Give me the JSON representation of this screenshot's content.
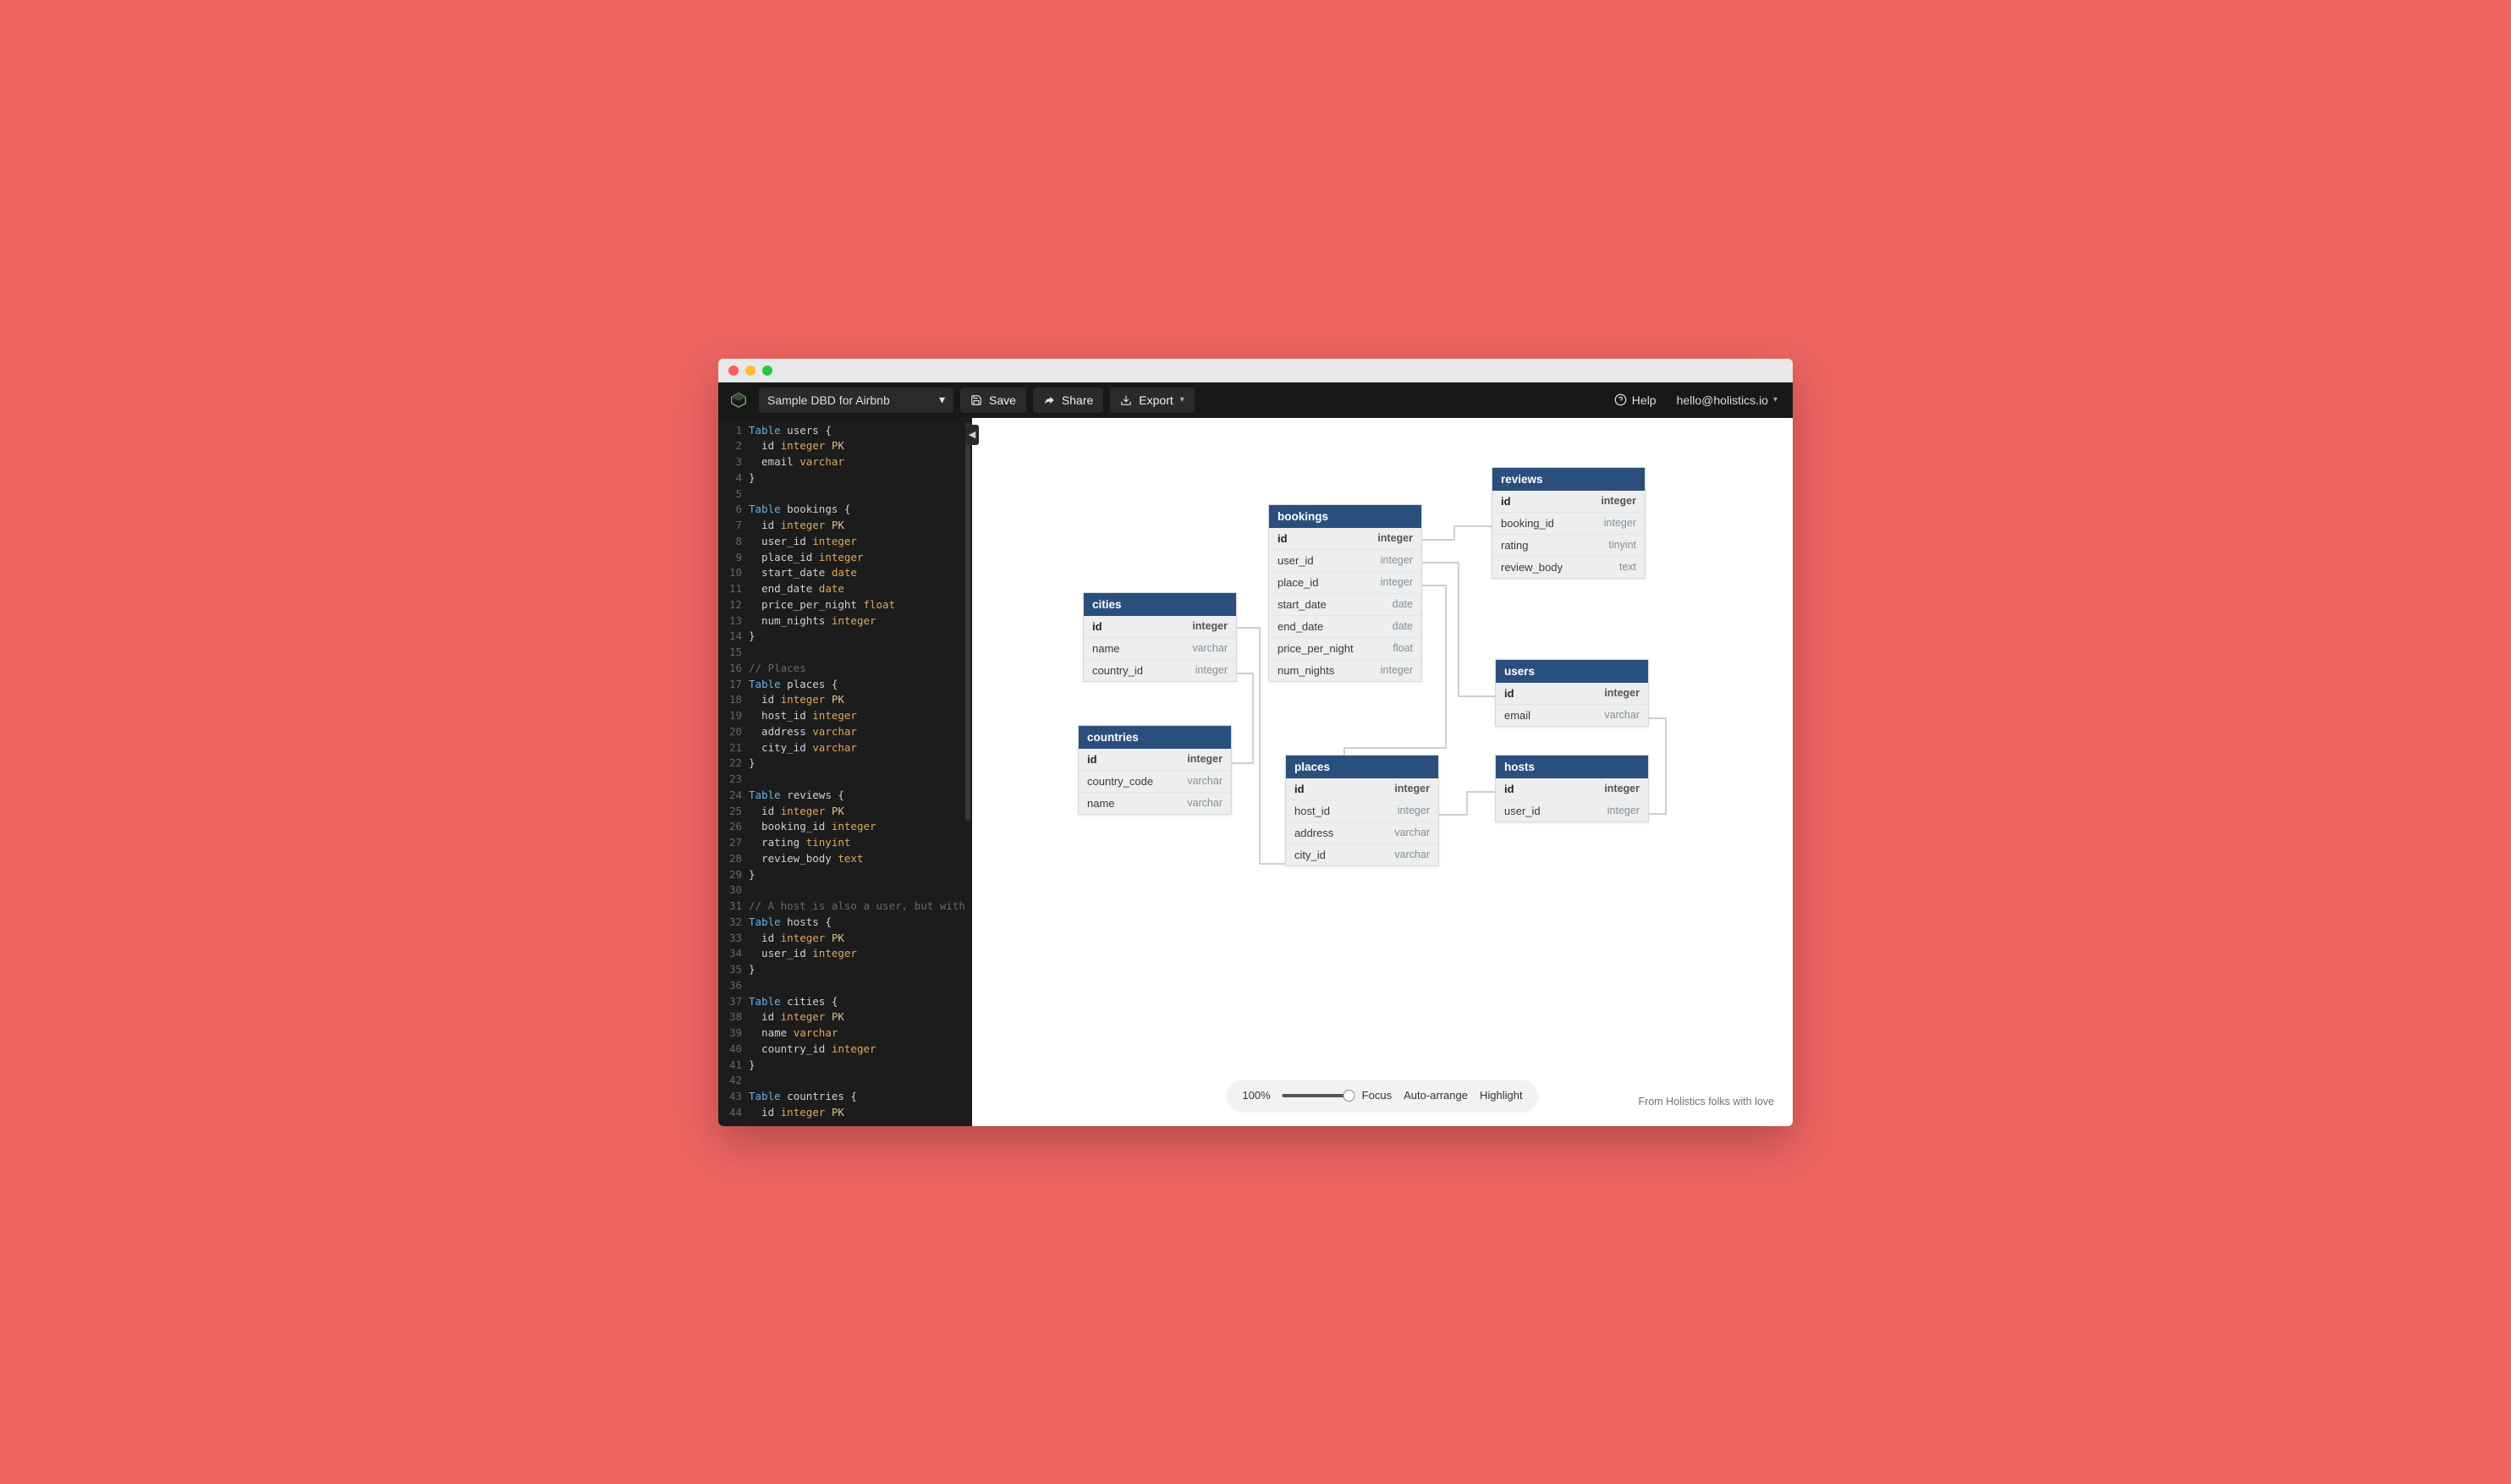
{
  "toolbar": {
    "doc_title": "Sample DBD for Airbnb",
    "save": "Save",
    "share": "Share",
    "export": "Export",
    "help": "Help",
    "user": "hello@holistics.io"
  },
  "tables": {
    "cities": {
      "name": "cities",
      "cols": [
        {
          "name": "id",
          "type": "integer",
          "pk": true
        },
        {
          "name": "name",
          "type": "varchar"
        },
        {
          "name": "country_id",
          "type": "integer"
        }
      ]
    },
    "countries": {
      "name": "countries",
      "cols": [
        {
          "name": "id",
          "type": "integer",
          "pk": true
        },
        {
          "name": "country_code",
          "type": "varchar"
        },
        {
          "name": "name",
          "type": "varchar"
        }
      ]
    },
    "bookings": {
      "name": "bookings",
      "cols": [
        {
          "name": "id",
          "type": "integer",
          "pk": true
        },
        {
          "name": "user_id",
          "type": "integer"
        },
        {
          "name": "place_id",
          "type": "integer"
        },
        {
          "name": "start_date",
          "type": "date"
        },
        {
          "name": "end_date",
          "type": "date"
        },
        {
          "name": "price_per_night",
          "type": "float"
        },
        {
          "name": "num_nights",
          "type": "integer"
        }
      ]
    },
    "places": {
      "name": "places",
      "cols": [
        {
          "name": "id",
          "type": "integer",
          "pk": true
        },
        {
          "name": "host_id",
          "type": "integer"
        },
        {
          "name": "address",
          "type": "varchar"
        },
        {
          "name": "city_id",
          "type": "varchar"
        }
      ]
    },
    "reviews": {
      "name": "reviews",
      "cols": [
        {
          "name": "id",
          "type": "integer",
          "pk": true
        },
        {
          "name": "booking_id",
          "type": "integer"
        },
        {
          "name": "rating",
          "type": "tinyint"
        },
        {
          "name": "review_body",
          "type": "text"
        }
      ]
    },
    "users": {
      "name": "users",
      "cols": [
        {
          "name": "id",
          "type": "integer",
          "pk": true
        },
        {
          "name": "email",
          "type": "varchar"
        }
      ]
    },
    "hosts": {
      "name": "hosts",
      "cols": [
        {
          "name": "id",
          "type": "integer",
          "pk": true
        },
        {
          "name": "user_id",
          "type": "integer"
        }
      ]
    }
  },
  "editor": {
    "lines": [
      [
        [
          "kw",
          "Table"
        ],
        [
          "id",
          " users {"
        ]
      ],
      [
        [
          "id",
          "  id "
        ],
        [
          "type",
          "integer"
        ],
        [
          "mod",
          " PK"
        ]
      ],
      [
        [
          "id",
          "  email "
        ],
        [
          "type",
          "varchar"
        ]
      ],
      [
        [
          "id",
          "}"
        ]
      ],
      [
        [
          "id",
          ""
        ]
      ],
      [
        [
          "kw",
          "Table"
        ],
        [
          "id",
          " bookings {"
        ]
      ],
      [
        [
          "id",
          "  id "
        ],
        [
          "type",
          "integer"
        ],
        [
          "mod",
          " PK"
        ]
      ],
      [
        [
          "id",
          "  user_id "
        ],
        [
          "type",
          "integer"
        ]
      ],
      [
        [
          "id",
          "  place_id "
        ],
        [
          "type",
          "integer"
        ]
      ],
      [
        [
          "id",
          "  start_date "
        ],
        [
          "type",
          "date"
        ]
      ],
      [
        [
          "id",
          "  end_date "
        ],
        [
          "type",
          "date"
        ]
      ],
      [
        [
          "id",
          "  price_per_night "
        ],
        [
          "type",
          "float"
        ]
      ],
      [
        [
          "id",
          "  num_nights "
        ],
        [
          "type",
          "integer"
        ]
      ],
      [
        [
          "id",
          "}"
        ]
      ],
      [
        [
          "id",
          ""
        ]
      ],
      [
        [
          "cm",
          "// Places"
        ]
      ],
      [
        [
          "kw",
          "Table"
        ],
        [
          "id",
          " places {"
        ]
      ],
      [
        [
          "id",
          "  id "
        ],
        [
          "type",
          "integer"
        ],
        [
          "mod",
          " PK"
        ]
      ],
      [
        [
          "id",
          "  host_id "
        ],
        [
          "type",
          "integer"
        ]
      ],
      [
        [
          "id",
          "  address "
        ],
        [
          "type",
          "varchar"
        ]
      ],
      [
        [
          "id",
          "  city_id "
        ],
        [
          "type",
          "varchar"
        ]
      ],
      [
        [
          "id",
          "}"
        ]
      ],
      [
        [
          "id",
          ""
        ]
      ],
      [
        [
          "kw",
          "Table"
        ],
        [
          "id",
          " reviews {"
        ]
      ],
      [
        [
          "id",
          "  id "
        ],
        [
          "type",
          "integer"
        ],
        [
          "mod",
          " PK"
        ]
      ],
      [
        [
          "id",
          "  booking_id "
        ],
        [
          "type",
          "integer"
        ]
      ],
      [
        [
          "id",
          "  rating "
        ],
        [
          "type",
          "tinyint"
        ]
      ],
      [
        [
          "id",
          "  review_body "
        ],
        [
          "type",
          "text"
        ]
      ],
      [
        [
          "id",
          "}"
        ]
      ],
      [
        [
          "id",
          ""
        ]
      ],
      [
        [
          "cm",
          "// A host is also a user, but with ad"
        ]
      ],
      [
        [
          "kw",
          "Table"
        ],
        [
          "id",
          " hosts {"
        ]
      ],
      [
        [
          "id",
          "  id "
        ],
        [
          "type",
          "integer"
        ],
        [
          "mod",
          " PK"
        ]
      ],
      [
        [
          "id",
          "  user_id "
        ],
        [
          "type",
          "integer"
        ]
      ],
      [
        [
          "id",
          "}"
        ]
      ],
      [
        [
          "id",
          ""
        ]
      ],
      [
        [
          "kw",
          "Table"
        ],
        [
          "id",
          " cities {"
        ]
      ],
      [
        [
          "id",
          "  id "
        ],
        [
          "type",
          "integer"
        ],
        [
          "mod",
          " PK"
        ]
      ],
      [
        [
          "id",
          "  name "
        ],
        [
          "type",
          "varchar"
        ]
      ],
      [
        [
          "id",
          "  country_id "
        ],
        [
          "type",
          "integer"
        ]
      ],
      [
        [
          "id",
          "}"
        ]
      ],
      [
        [
          "id",
          ""
        ]
      ],
      [
        [
          "kw",
          "Table"
        ],
        [
          "id",
          " countries {"
        ]
      ],
      [
        [
          "id",
          "  id "
        ],
        [
          "type",
          "integer"
        ],
        [
          "mod",
          " PK"
        ]
      ]
    ]
  },
  "controls": {
    "zoom": "100%",
    "focus": "Focus",
    "auto": "Auto-arrange",
    "highlight": "Highlight"
  },
  "credit": "From Holistics folks with love"
}
